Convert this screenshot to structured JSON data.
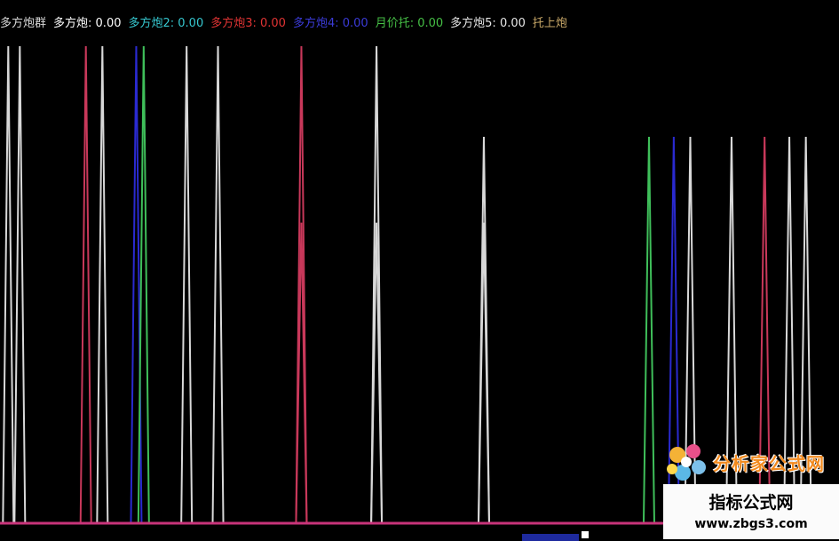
{
  "legend": [
    {
      "label": "多方炮群",
      "value": "",
      "color": "#d8d8d8"
    },
    {
      "label": "多方炮:",
      "value": "0.00",
      "color": "#ffffff"
    },
    {
      "label": "多方炮2:",
      "value": "0.00",
      "color": "#36c8d0"
    },
    {
      "label": "多方炮3:",
      "value": "0.00",
      "color": "#e23434"
    },
    {
      "label": "多方炮4:",
      "value": "0.00",
      "color": "#3b3bd8"
    },
    {
      "label": "月价托:",
      "value": "0.00",
      "color": "#46c046"
    },
    {
      "label": "多方炮5:",
      "value": "0.00",
      "color": "#e6e6e6"
    },
    {
      "label": "托上炮",
      "value": "",
      "color": "#c8a868"
    }
  ],
  "colors": {
    "background": "#000000",
    "baseline": "#c8347a",
    "white_series": "#d8d8d8",
    "red_series": "#c8385a",
    "blue_series": "#2a2ad0",
    "green_series": "#3fbf5a"
  },
  "chart_data": {
    "type": "line",
    "x_range": [
      0,
      100
    ],
    "y_range": [
      0,
      1
    ],
    "baseline_y": 0,
    "spikes": [
      {
        "x": 1.0,
        "y": 1.0,
        "series": "white"
      },
      {
        "x": 2.4,
        "y": 1.0,
        "series": "white"
      },
      {
        "x": 10.4,
        "y": 1.0,
        "series": "red"
      },
      {
        "x": 12.4,
        "y": 1.0,
        "series": "white"
      },
      {
        "x": 16.5,
        "y": 1.0,
        "series": "blue"
      },
      {
        "x": 17.4,
        "y": 1.0,
        "series": "green"
      },
      {
        "x": 22.6,
        "y": 1.0,
        "series": "white"
      },
      {
        "x": 26.4,
        "y": 1.0,
        "series": "white"
      },
      {
        "x": 36.5,
        "y": 0.63,
        "series": "red"
      },
      {
        "x": 36.5,
        "y": 1.0,
        "series": "red"
      },
      {
        "x": 45.6,
        "y": 0.63,
        "series": "white"
      },
      {
        "x": 45.6,
        "y": 1.0,
        "series": "white"
      },
      {
        "x": 58.6,
        "y": 0.63,
        "series": "white"
      },
      {
        "x": 58.6,
        "y": 0.81,
        "series": "white"
      },
      {
        "x": 78.6,
        "y": 0.81,
        "series": "green"
      },
      {
        "x": 81.6,
        "y": 0.81,
        "series": "blue"
      },
      {
        "x": 83.6,
        "y": 0.81,
        "series": "white"
      },
      {
        "x": 88.6,
        "y": 0.81,
        "series": "white"
      },
      {
        "x": 92.6,
        "y": 0.81,
        "series": "red"
      },
      {
        "x": 95.6,
        "y": 0.81,
        "series": "white"
      },
      {
        "x": 97.6,
        "y": 0.81,
        "series": "white"
      }
    ]
  },
  "watermark": {
    "brand": "分析家公式网",
    "title": "指标公式网",
    "url": "www.zbgs3.com"
  }
}
